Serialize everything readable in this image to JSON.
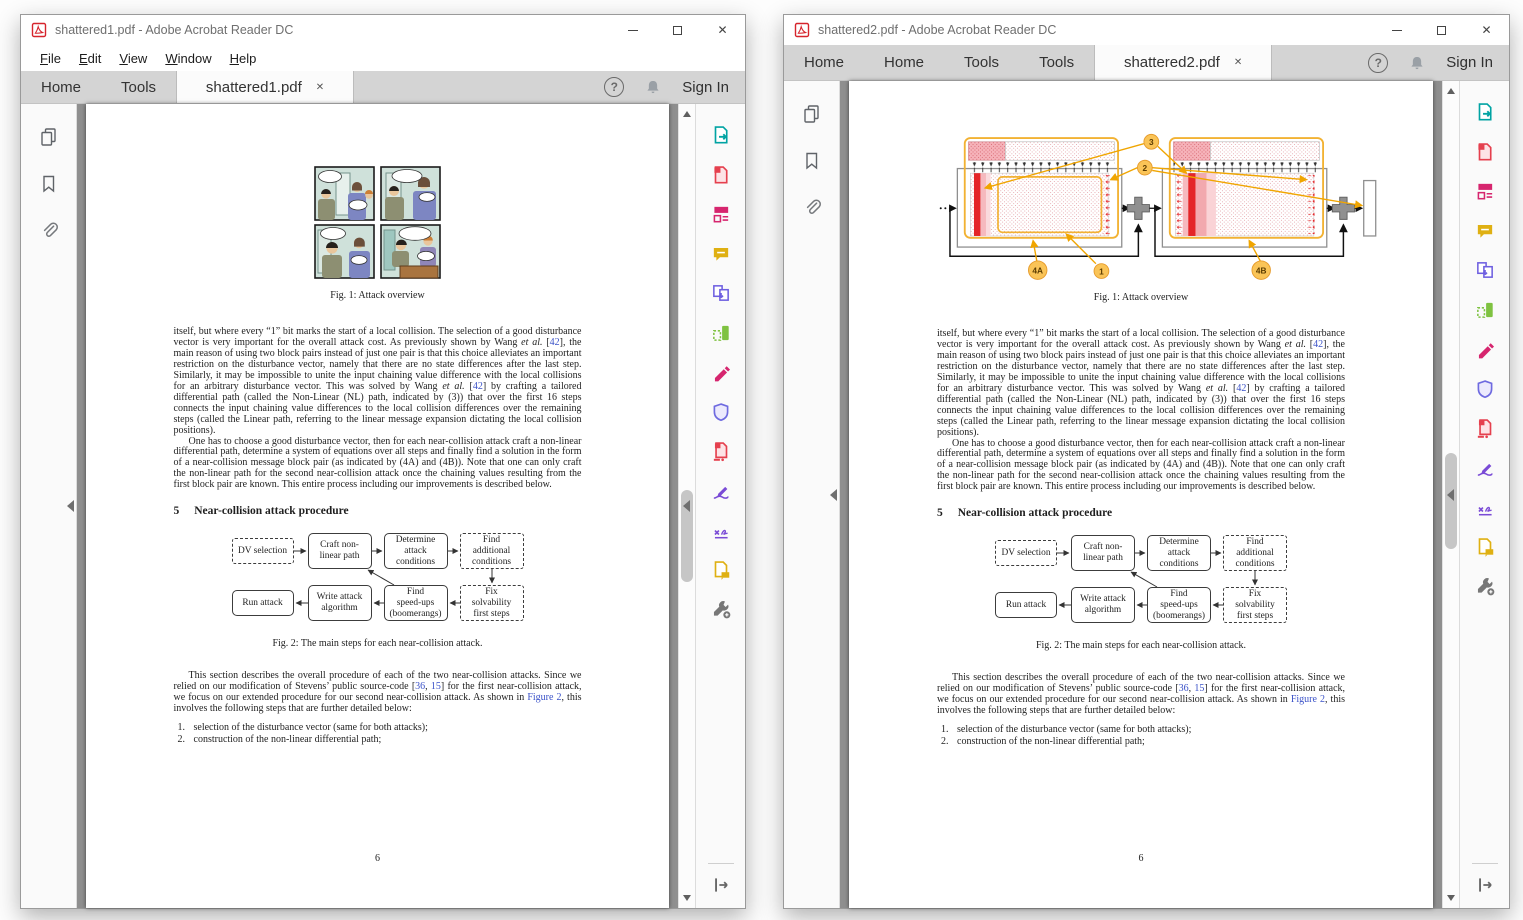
{
  "window1": {
    "title": "shattered1.pdf - Adobe Acrobat Reader DC",
    "menu": [
      {
        "u": "F",
        "rest": "ile"
      },
      {
        "u": "E",
        "rest": "dit"
      },
      {
        "u": "V",
        "rest": "iew"
      },
      {
        "u": "W",
        "rest": "indow"
      },
      {
        "u": "H",
        "rest": "elp"
      }
    ],
    "tabs": [
      "Home",
      "Tools"
    ],
    "doc_tab": "shattered1.pdf",
    "sign_in": "Sign In"
  },
  "window2": {
    "title": "shattered2.pdf - Adobe Acrobat Reader DC",
    "tabs": [
      "Home",
      "Home",
      "Tools",
      "Tools"
    ],
    "doc_tab": "shattered2.pdf",
    "sign_in": "Sign In"
  },
  "chrome": {
    "close_glyph": "✕",
    "tab_close_glyph": "✕",
    "help_glyph": "?"
  },
  "doc": {
    "fig1_caption": "Fig. 1: Attack overview",
    "para1": {
      "t1": "itself, but where every “1” bit marks the start of a local collision. The selection of a good disturbance vector is very important for the overall attack cost. As previously shown by Wang ",
      "i1": "et al.",
      "t2": " [",
      "ref1": "42",
      "t3": "], the main reason of using two block pairs instead of just one pair is that this choice alleviates an important restriction on the disturbance vector, namely that there are no state differences after the last step. Similarly, it may be impossible to unite the input chaining value difference with the local collisions for an arbitrary disturbance vector. This was solved by Wang ",
      "i2": "et al.",
      "t4": " [",
      "ref2": "42",
      "t5": "] by crafting a tailored differential path (called the Non-Linear (NL) path, indicated by (3)) that over the first 16 steps connects the input chaining value differences to the local collision differences over the remaining steps (called the Linear path, referring to the linear message expansion dictating the local collision positions)."
    },
    "para2": "One has to choose a good disturbance vector, then for each near-collision attack craft a non-linear differential path, determine a system of equations over all steps and finally find a solution in the form of a near-collision message block pair (as indicated by (4A) and (4B)). Note that one can only craft the non-linear path for the second near-collision attack once the chaining values resulting from the first block pair are known. This entire process including our improvements is described below.",
    "section5": {
      "number": "5",
      "title": "Near-collision attack procedure"
    },
    "flowchart": {
      "dv": "DV selection",
      "craft": "Craft non-\nlinear path",
      "determine": "Determine\nattack\nconditions",
      "find_additional": "Find\nadditional\nconditions",
      "run": "Run attack",
      "write": "Write attack\nalgorithm",
      "speedups": "Find\nspeed-ups\n(boomerangs)",
      "fix": "Fix\nsolvability\nfirst steps"
    },
    "fig2_caption": "Fig. 2: The main steps for each near-collision attack.",
    "para3": {
      "t1": "This section describes the overall procedure of each of the two near-collision attacks. Since we relied on our modification of Stevens’ public source-code [",
      "ref1": "36",
      "t2": ", ",
      "ref2": "15",
      "t3": "] for the first near-collision attack, we focus on our extended procedure for our second near-collision attack. As shown in ",
      "ref3": "Figure 2",
      "t4": ", this involves the following steps that are further detailed below:"
    },
    "list": [
      {
        "num": "1.",
        "text": "selection of the disturbance vector (same for both attacks);"
      },
      {
        "num": "2.",
        "text": "construction of the non-linear differential path;"
      }
    ],
    "page_number": "6",
    "fig1_labels": {
      "n1": "1",
      "n2": "2",
      "n3": "3",
      "a": "4A",
      "b": "4B"
    }
  },
  "icons": {
    "nav_rail": [
      "page-thumbnails-icon",
      "bookmarks-icon",
      "attachments-icon"
    ],
    "tools_rail": [
      "export-pdf-icon",
      "create-pdf-icon",
      "edit-pdf-icon",
      "comment-icon",
      "combine-files-icon",
      "organize-pages-icon",
      "redact-icon",
      "protect-icon",
      "compress-pdf-icon",
      "fill-sign-icon",
      "request-signatures-icon",
      "send-and-track-icon",
      "more-tools-icon"
    ],
    "other": [
      "pdf-file-icon",
      "help-icon",
      "bell-icon",
      "expand-pane-icon",
      "collapse-pane-arrow"
    ]
  },
  "colors": {
    "link_blue": "#3b52c8",
    "tab_bar": "#d4d4d4",
    "doc_background": "#8f8f8f",
    "tool_teal": "#00a3a3",
    "tool_red": "#e5404e",
    "tool_magenta": "#d6256e",
    "tool_yellow": "#dfb012",
    "tool_violet": "#6e5fe0",
    "tool_green": "#7fc241",
    "tool_purple": "#7a4bd6",
    "diagram_yellow": "#f2b233",
    "diagram_red": "#e42528"
  }
}
